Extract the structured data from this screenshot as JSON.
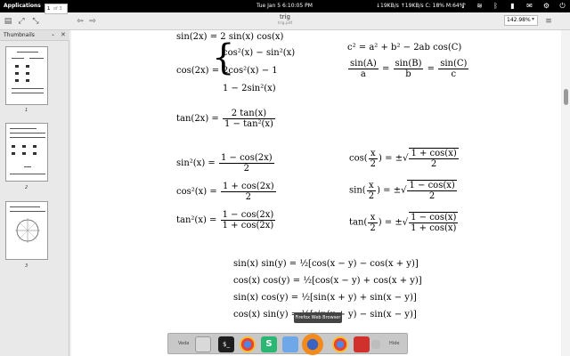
{
  "panel": {
    "apps": "Applications",
    "clock": "Tue Jan  5    6:10:05 PM",
    "netstat": "↓19KB/s ↑19KB/s  C: 18%  M:64%"
  },
  "toolbar": {
    "page_current": "1",
    "page_total": "of 3",
    "doc_title": "trig",
    "doc_subtitle": "trig.pdf",
    "zoom": "142.98%"
  },
  "sidebar": {
    "title": "Thumbnails",
    "pages": [
      "1",
      "2",
      "3"
    ]
  },
  "formulas": {
    "sin2x_lhs": "sin(2x) = 2 sin(x) cos(x)",
    "cos2x_lhs": "cos(2x) =",
    "cos2x_case1": "cos²(x) − sin²(x)",
    "cos2x_case2": "2cos²(x) − 1",
    "cos2x_case3": "1 − 2sin²(x)",
    "tan2x_lhs": "tan(2x) =",
    "tan2x_num": "2 tan(x)",
    "tan2x_den": "1 − tan²(x)",
    "law_cos": "c² = a² + b² − 2ab cos(C)",
    "law_sin_a_num": "sin(A)",
    "law_sin_a_den": "a",
    "law_sin_b_num": "sin(B)",
    "law_sin_b_den": "b",
    "law_sin_c_num": "sin(C)",
    "law_sin_c_den": "c",
    "sin2_lhs": "sin²(x) =",
    "sin2_num": "1 − cos(2x)",
    "sin2_den": "2",
    "cos2_lhs": "cos²(x) =",
    "cos2_num": "1 + cos(2x)",
    "cos2_den": "2",
    "tan2_lhs": "tan²(x) =",
    "tan2_num": "1 − cos(2x)",
    "tan2_den": "1 + cos(2x)",
    "half_cos_lhs": "cos",
    "half_cos_rhs_num": "1 + cos(x)",
    "half_cos_rhs_den": "2",
    "half_sin_lhs": "sin",
    "half_sin_rhs_num": "1 − cos(x)",
    "half_sin_rhs_den": "2",
    "half_tan_lhs": "tan",
    "half_tan_rhs_num": "1 − cos(x)",
    "half_tan_rhs_den": "1 + cos(x)",
    "half_x": "x",
    "half_two": "2",
    "pm_sqrt": "= ±√",
    "prod1": "sin(x) sin(y) = ½[cos(x − y) − cos(x + y)]",
    "prod2": "cos(x) cos(y) = ½[cos(x − y) + cos(x + y)]",
    "prod3": "sin(x) cos(y) = ½[sin(x + y) + sin(x − y)]",
    "prod4": "cos(x) sin(y) = ½[sin(x + y) − sin(x − y)]"
  },
  "dock": {
    "left_label": "Veda",
    "right_label": "Hide",
    "tooltip": "Firefox Web Browser"
  }
}
